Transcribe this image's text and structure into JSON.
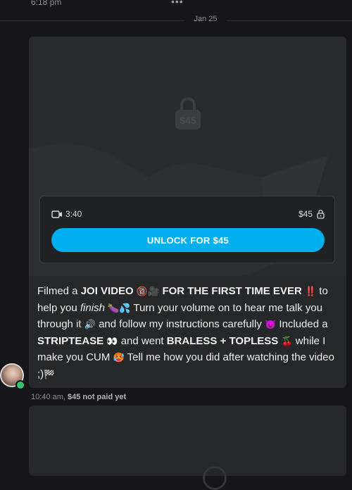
{
  "header": {
    "time": "6:18 pm",
    "more_icon": "more-dots-icon",
    "date_divider": "Jan 25"
  },
  "message": {
    "locked_price_label": "$45",
    "video_duration": "3:40",
    "price": "$45",
    "unlock_button": "UNLOCK FOR $45",
    "caption": {
      "p1": "Filmed a ",
      "b1": "JOI VIDEO",
      "e1": "🔞🎥",
      "b2": "FOR THE FIRST TIME EVER",
      "e2": "‼️",
      "p2": " to help you ",
      "i1": "finish",
      "e3": "🍆💦",
      "p3": " Turn your volume on to hear me talk you through it ",
      "e4": "🔊",
      "p4": " and follow my instructions carefully ",
      "e5": "😈",
      "p5": " In­cluded a ",
      "b3": "STRIPTEASE",
      "e6": "👀",
      "p6": " and went ",
      "b4": "BRALESS + TOPLESS",
      "e7": "🍒",
      "p7": " while I make you CUM ",
      "e8": "🥵",
      "p8": " Tell me how you did after watching the video ;)",
      "e9": "🏁"
    },
    "timestamp": "10:40 am,",
    "payment_status": "$45 not paid yet"
  },
  "colors": {
    "accent": "#00aff0",
    "background": "#161618",
    "card": "#262729",
    "online": "#38c172"
  }
}
